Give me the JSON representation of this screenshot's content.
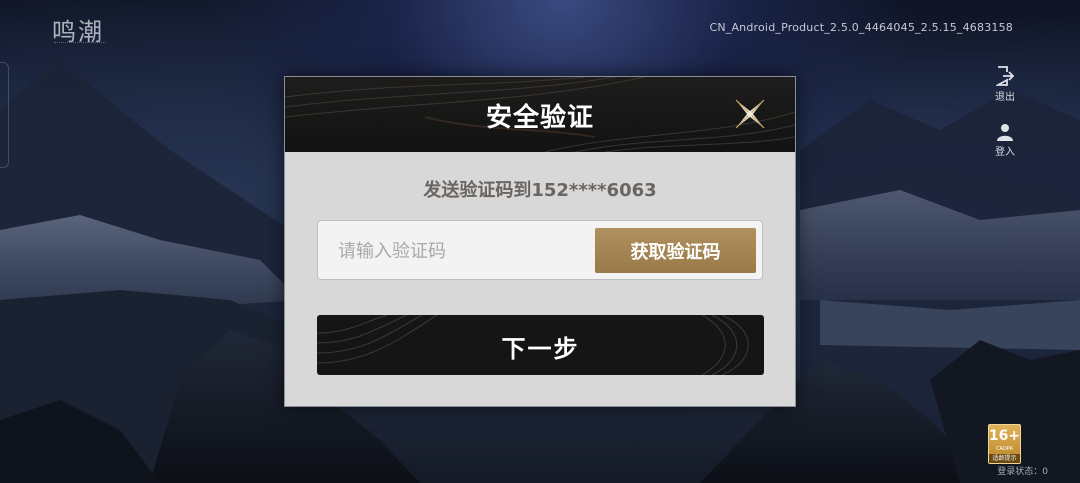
{
  "app": {
    "logo_text": "鸣潮",
    "version": "CN_Android_Product_2.5.0_4464045_2.5.15_4683158"
  },
  "side": {
    "exit_label": "退出",
    "login_label": "登入"
  },
  "age_rating": {
    "age": "16+",
    "org": "CADPA",
    "tip": "适龄提示"
  },
  "login_status": "登录状态：0",
  "dialog": {
    "title": "安全验证",
    "send_text": "发送验证码到152****6063",
    "code_input": {
      "value": "",
      "placeholder": "请输入验证码"
    },
    "get_code_label": "获取验证码",
    "next_label": "下一步",
    "close_icon": "close-x-icon"
  },
  "colors": {
    "accent_gold": "#a88656",
    "header_dark": "#151515",
    "body_grey": "#d8d8d8"
  }
}
